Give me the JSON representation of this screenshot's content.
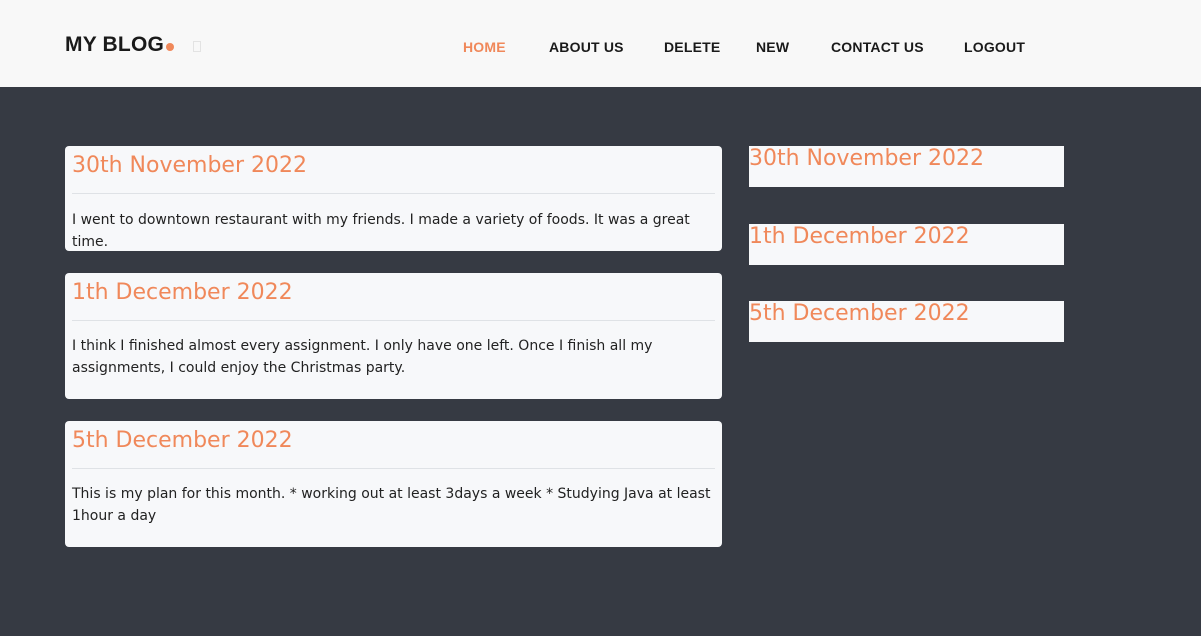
{
  "header": {
    "logo": "MY BLOG",
    "nav": [
      {
        "label": "HOME",
        "active": true
      },
      {
        "label": "ABOUT US",
        "active": false
      },
      {
        "label": "DELETE",
        "active": false
      },
      {
        "label": "NEW",
        "active": false
      },
      {
        "label": "CONTACT US",
        "active": false
      },
      {
        "label": "LOGOUT",
        "active": false
      }
    ]
  },
  "posts": [
    {
      "title": "30th November 2022",
      "body": "I went to downtown restaurant with my friends. I made a variety of foods. It was a great time."
    },
    {
      "title": "1th December 2022",
      "body": "I think I finished almost every assignment. I only have one left. Once I finish all my assignments, I could enjoy the Christmas party."
    },
    {
      "title": "5th December 2022",
      "body": "This is my plan for this month. * working out at least 3days a week * Studying Java at least 1hour a day"
    }
  ],
  "sidebar": {
    "items": [
      {
        "label": "30th November 2022"
      },
      {
        "label": "1th December 2022"
      },
      {
        "label": "5th December 2022"
      }
    ]
  },
  "colors": {
    "accent": "#f0885a",
    "background": "#363a43",
    "header": "#f8f8f8",
    "card": "#f7f8fa"
  }
}
